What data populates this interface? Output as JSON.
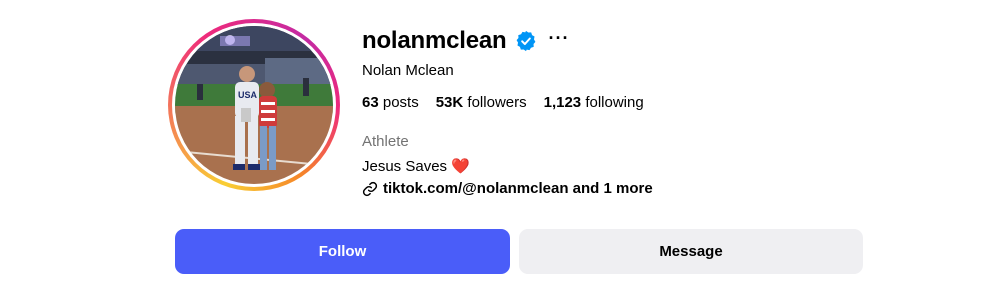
{
  "profile": {
    "username": "nolanmclean",
    "full_name": "Nolan Mclean",
    "verified_icon": "verified-badge-icon",
    "more_label": "···",
    "stats": {
      "posts_count": "63",
      "posts_label": "posts",
      "followers_count": "53K",
      "followers_label": "followers",
      "following_count": "1,123",
      "following_label": "following"
    },
    "category": "Athlete",
    "bio": "Jesus Saves",
    "bio_emoji": "❤️",
    "link": "tiktok.com/@nolanmclean and 1 more"
  },
  "actions": {
    "follow_label": "Follow",
    "message_label": "Message"
  },
  "colors": {
    "follow_button": "#4a5df9",
    "message_button": "#efeff2",
    "verified_badge": "#0095f6",
    "category_text": "#737373"
  }
}
